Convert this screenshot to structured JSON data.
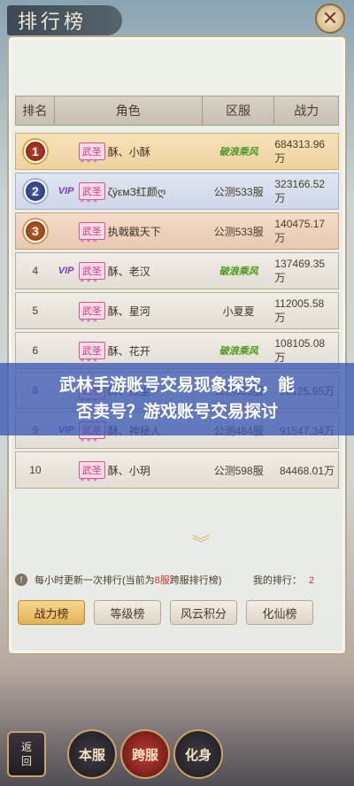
{
  "header": {
    "title": "排行榜",
    "close_label": "✕"
  },
  "table": {
    "columns": [
      "排名",
      "角色",
      "区服",
      "战力"
    ],
    "rows": [
      {
        "rank": "1",
        "medal": "gold",
        "vip": false,
        "title": "武圣",
        "name": "酥、小酥",
        "server": "破浪乘风",
        "server_special": true,
        "power": "684313.96万"
      },
      {
        "rank": "2",
        "medal": "silver",
        "vip": true,
        "title": "武圣",
        "name": "ζÿεмЗ红颜ღ",
        "server": "公测533服",
        "server_special": false,
        "power": "323166.52万"
      },
      {
        "rank": "3",
        "medal": "bronze",
        "vip": false,
        "title": "武圣",
        "name": "执戟戳天下",
        "server": "公测533服",
        "server_special": false,
        "power": "140475.17万"
      },
      {
        "rank": "4",
        "medal": "",
        "vip": true,
        "title": "武圣",
        "name": "酥、老汉",
        "server": "破浪乘风",
        "server_special": true,
        "power": "137469.35万"
      },
      {
        "rank": "5",
        "medal": "",
        "vip": false,
        "title": "武圣",
        "name": "酥、星河",
        "server": "小夏夏",
        "server_special": false,
        "power": "112005.58万"
      },
      {
        "rank": "6",
        "medal": "",
        "vip": false,
        "title": "武圣",
        "name": "酥、花开",
        "server": "破浪乘风",
        "server_special": true,
        "power": "108105.08万"
      },
      {
        "rank": "8",
        "medal": "",
        "vip": false,
        "title": "武圣",
        "name": "酥、红尘",
        "server": "公测533服",
        "server_special": false,
        "power": "92125.95万"
      },
      {
        "rank": "9",
        "medal": "",
        "vip": true,
        "title": "武圣",
        "name": "酥、神秘人",
        "server": "公测484服",
        "server_special": false,
        "power": "91547.34万"
      },
      {
        "rank": "10",
        "medal": "",
        "vip": false,
        "title": "武圣",
        "name": "酥、小玥",
        "server": "公测598服",
        "server_special": false,
        "power": "84468.01万"
      }
    ]
  },
  "overlay": {
    "line1": "武林手游账号交易现象探究，能",
    "line2": "否卖号？游戏账号交易探讨"
  },
  "info": {
    "prefix": "每小时更新一次排行(当前为",
    "highlight": "8服",
    "suffix": "跨服排行榜)",
    "my_rank_label": "我的排行：",
    "my_rank_value": "2"
  },
  "tabs": [
    "战力榜",
    "等级榜",
    "风云积分",
    "化仙榜"
  ],
  "nav": {
    "back_line1": "返",
    "back_line2": "回",
    "items": [
      "本服",
      "跨服",
      "化身"
    ]
  },
  "vip_label": "VIP",
  "chevron": "︾"
}
